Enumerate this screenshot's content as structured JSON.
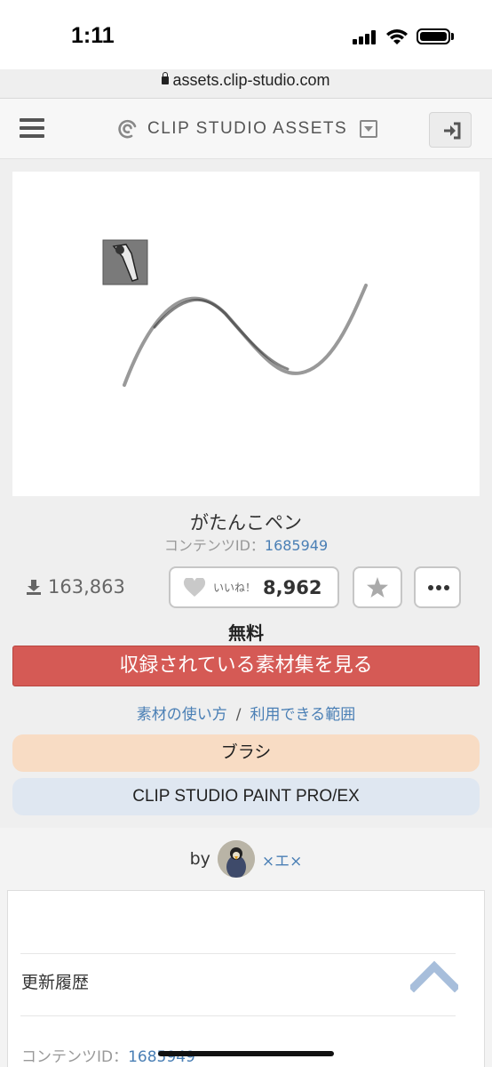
{
  "status_bar": {
    "time": "1:11"
  },
  "browser": {
    "url": "assets.clip-studio.com"
  },
  "header": {
    "brand_name": "CLIP STUDIO ASSETS"
  },
  "material": {
    "title": "がたんこペン",
    "content_id_label": "コンテンツID：",
    "content_id": "1685949",
    "downloads": "163,863",
    "like_label": "いいね！",
    "like_count": "8,962",
    "price": "無料",
    "cta_label": "収録されている素材集を見る",
    "link_usage": "素材の使い方",
    "link_separator": "/",
    "link_scope": "利用できる範囲",
    "tags": [
      "ブラシ",
      "CLIP STUDIO PAINT PRO/EX"
    ]
  },
  "author": {
    "by_label": "by",
    "name": "×エ×"
  },
  "details": {
    "history_label": "更新履歴",
    "content_id_label": "コンテンツID：",
    "content_id": "1685949"
  },
  "colors": {
    "cta": "#d55a55",
    "link": "#4a7fb5",
    "tag_brush_bg": "#f8dcc4",
    "tag_app_bg": "#dfe7f1",
    "scroll_top": "#a7bedb"
  },
  "icons": [
    "lock-icon",
    "menu-icon",
    "brand-logo-icon",
    "brand-dropdown-icon",
    "login-icon",
    "pen-tool-icon",
    "download-icon",
    "heart-icon",
    "star-icon",
    "more-icon",
    "chevron-up-icon"
  ]
}
